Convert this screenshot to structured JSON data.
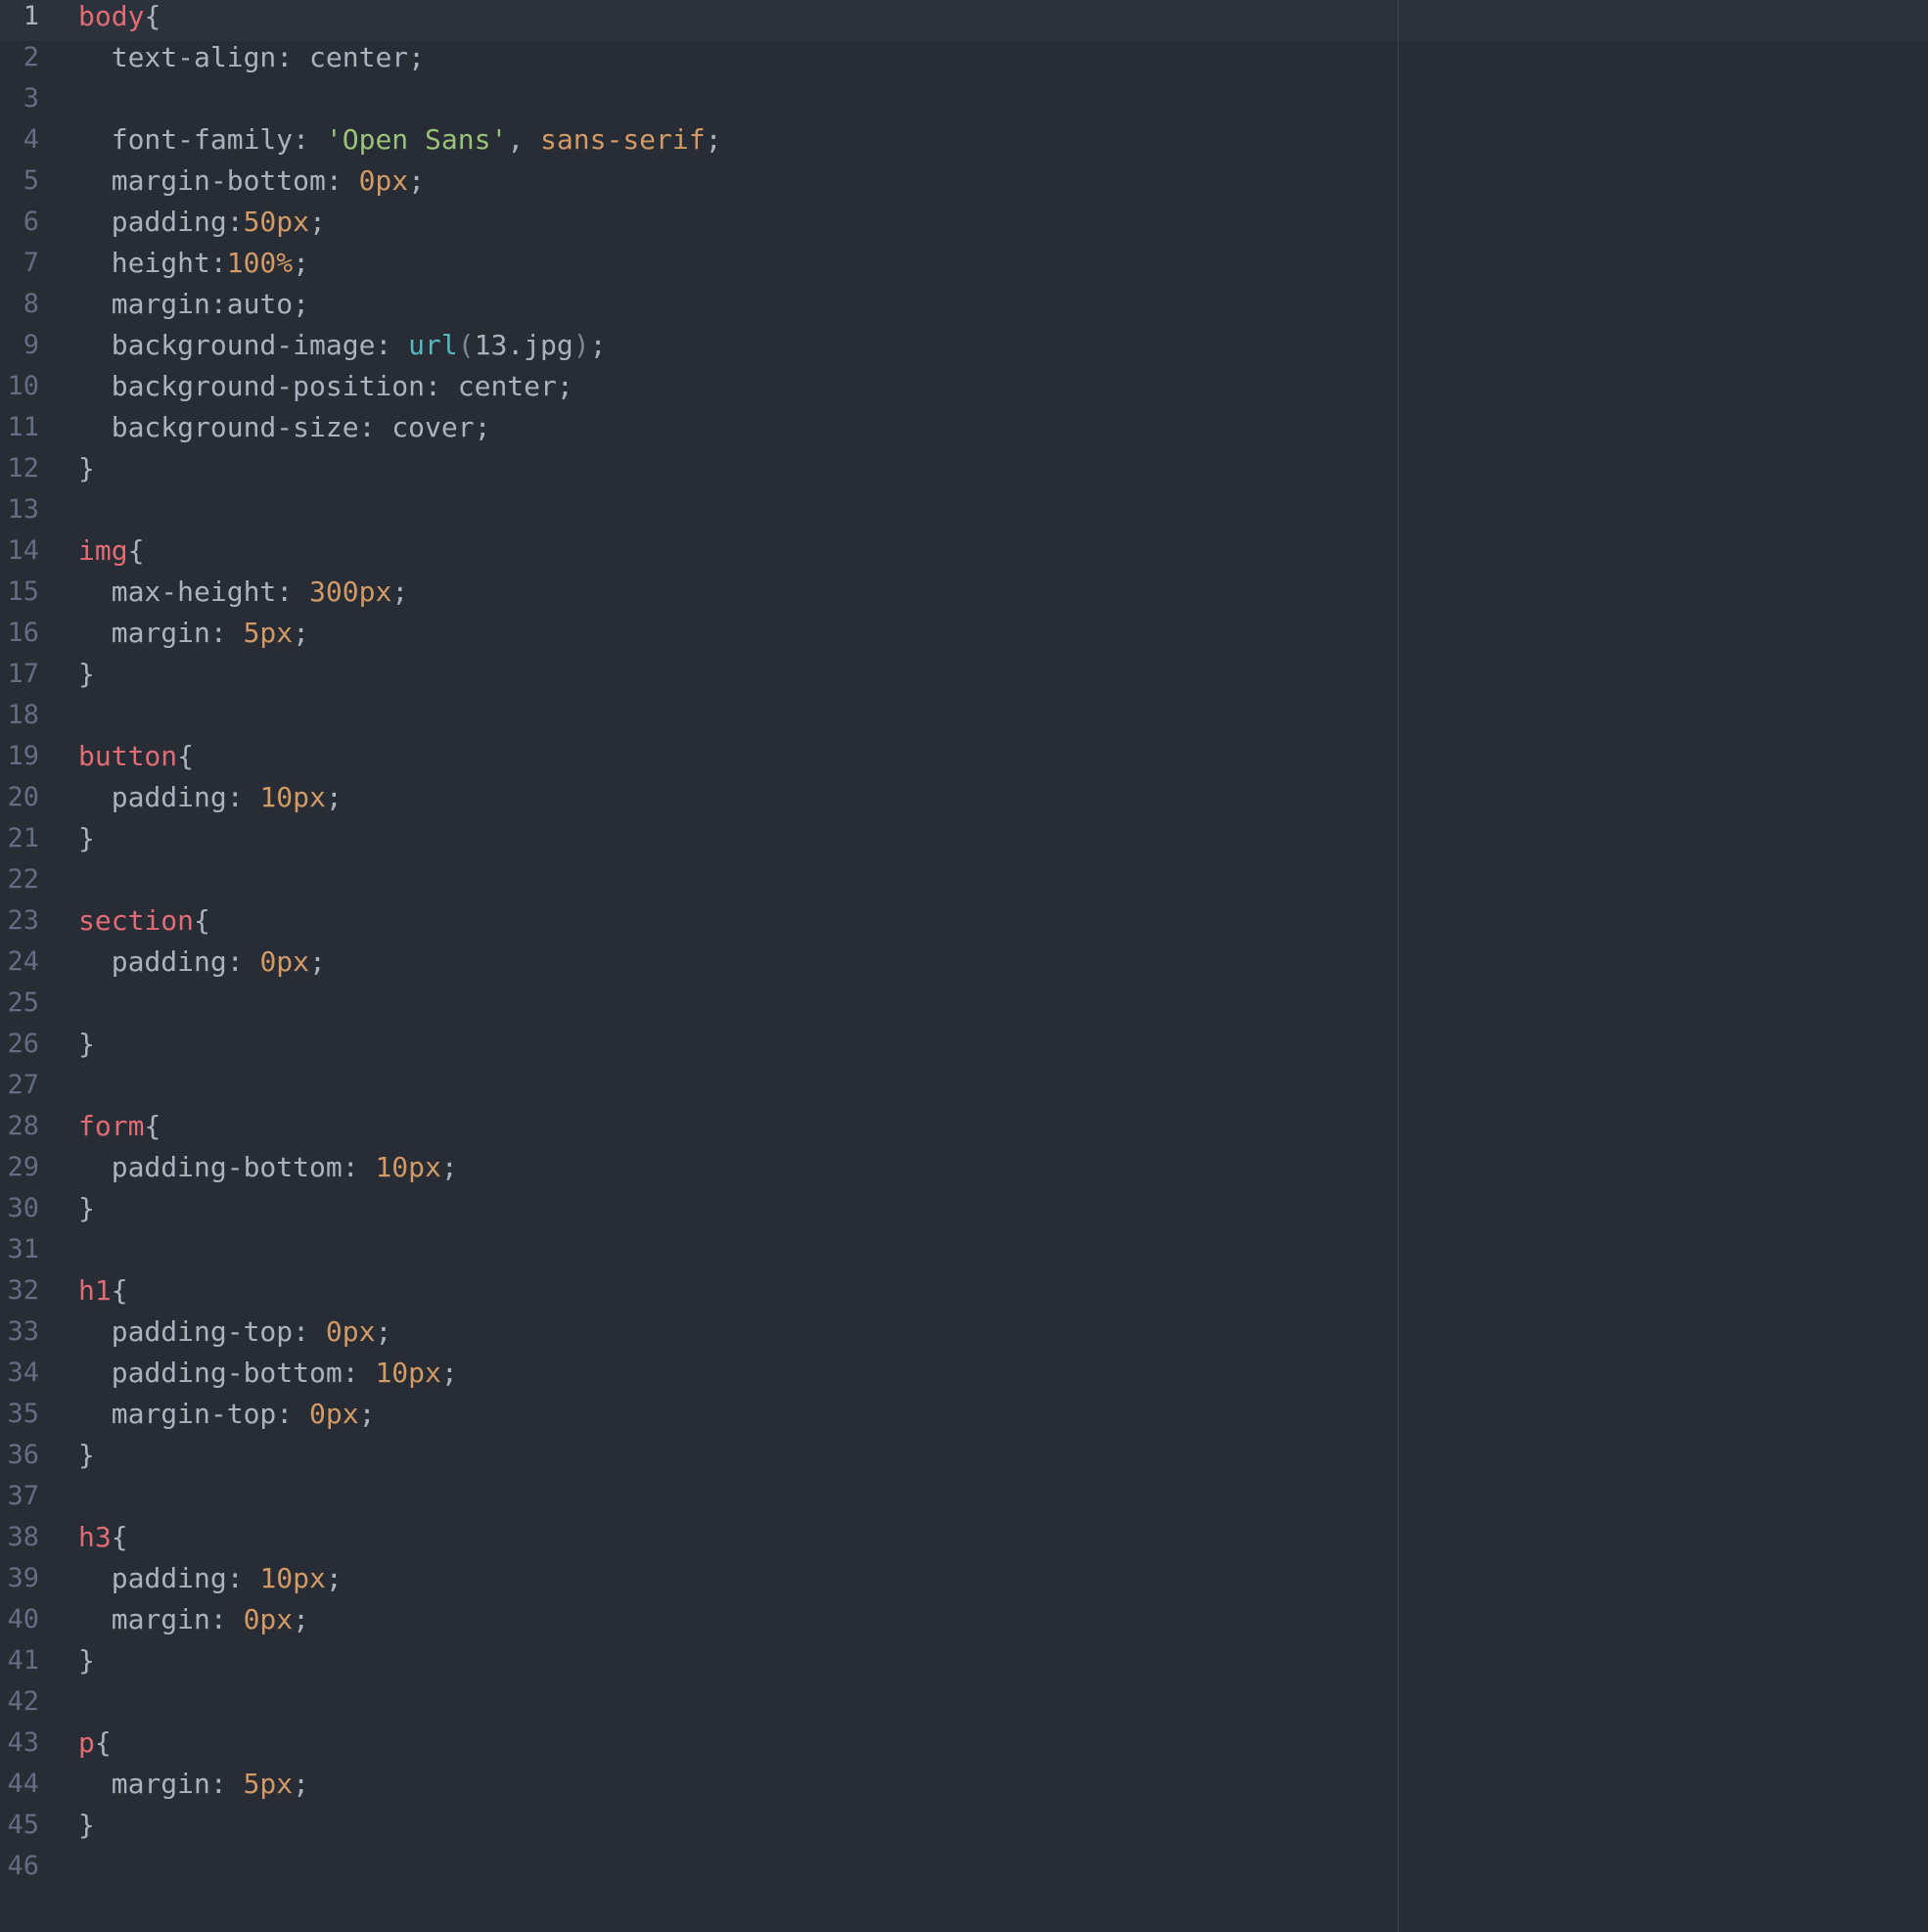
{
  "colors": {
    "background": "#282c34",
    "active_line": "#2d313b",
    "gutter_text": "#636d83",
    "selector": "#e06c75",
    "property": "#abb2bf",
    "number": "#d19a66",
    "string": "#98c379",
    "function": "#56b6c2",
    "wrap_guide": "#3e4451"
  },
  "editor": {
    "active_line": 1,
    "lines": [
      {
        "n": "1",
        "tokens": [
          {
            "t": "sel",
            "v": "body"
          },
          {
            "t": "punc",
            "v": "{"
          }
        ]
      },
      {
        "n": "2",
        "tokens": [
          {
            "t": "prop",
            "v": "  text-align: "
          },
          {
            "t": "plain",
            "v": "center"
          },
          {
            "t": "punc",
            "v": ";"
          }
        ]
      },
      {
        "n": "3",
        "tokens": []
      },
      {
        "n": "4",
        "tokens": [
          {
            "t": "prop",
            "v": "  font-family: "
          },
          {
            "t": "str",
            "v": "'Open Sans'"
          },
          {
            "t": "punc",
            "v": ", "
          },
          {
            "t": "kw",
            "v": "sans-serif"
          },
          {
            "t": "punc",
            "v": ";"
          }
        ]
      },
      {
        "n": "5",
        "tokens": [
          {
            "t": "prop",
            "v": "  margin-bottom: "
          },
          {
            "t": "num",
            "v": "0px"
          },
          {
            "t": "punc",
            "v": ";"
          }
        ]
      },
      {
        "n": "6",
        "tokens": [
          {
            "t": "prop",
            "v": "  padding:"
          },
          {
            "t": "num",
            "v": "50px"
          },
          {
            "t": "punc",
            "v": ";"
          }
        ]
      },
      {
        "n": "7",
        "tokens": [
          {
            "t": "prop",
            "v": "  height:"
          },
          {
            "t": "num",
            "v": "100%"
          },
          {
            "t": "punc",
            "v": ";"
          }
        ]
      },
      {
        "n": "8",
        "tokens": [
          {
            "t": "prop",
            "v": "  margin:"
          },
          {
            "t": "plain",
            "v": "auto"
          },
          {
            "t": "punc",
            "v": ";"
          }
        ]
      },
      {
        "n": "9",
        "tokens": [
          {
            "t": "prop",
            "v": "  background-image: "
          },
          {
            "t": "fn",
            "v": "url"
          },
          {
            "t": "paren",
            "v": "("
          },
          {
            "t": "plain",
            "v": "13.jpg"
          },
          {
            "t": "paren",
            "v": ")"
          },
          {
            "t": "punc",
            "v": ";"
          }
        ]
      },
      {
        "n": "10",
        "tokens": [
          {
            "t": "prop",
            "v": "  background-position: "
          },
          {
            "t": "plain",
            "v": "center"
          },
          {
            "t": "punc",
            "v": ";"
          }
        ]
      },
      {
        "n": "11",
        "tokens": [
          {
            "t": "prop",
            "v": "  background-size: "
          },
          {
            "t": "plain",
            "v": "cover"
          },
          {
            "t": "punc",
            "v": ";"
          }
        ]
      },
      {
        "n": "12",
        "tokens": [
          {
            "t": "punc",
            "v": "}"
          }
        ]
      },
      {
        "n": "13",
        "tokens": []
      },
      {
        "n": "14",
        "tokens": [
          {
            "t": "sel",
            "v": "img"
          },
          {
            "t": "punc",
            "v": "{"
          }
        ]
      },
      {
        "n": "15",
        "tokens": [
          {
            "t": "prop",
            "v": "  max-height: "
          },
          {
            "t": "num",
            "v": "300px"
          },
          {
            "t": "punc",
            "v": ";"
          }
        ]
      },
      {
        "n": "16",
        "tokens": [
          {
            "t": "prop",
            "v": "  margin: "
          },
          {
            "t": "num",
            "v": "5px"
          },
          {
            "t": "punc",
            "v": ";"
          }
        ]
      },
      {
        "n": "17",
        "tokens": [
          {
            "t": "punc",
            "v": "}"
          }
        ]
      },
      {
        "n": "18",
        "tokens": []
      },
      {
        "n": "19",
        "tokens": [
          {
            "t": "sel",
            "v": "button"
          },
          {
            "t": "punc",
            "v": "{"
          }
        ]
      },
      {
        "n": "20",
        "tokens": [
          {
            "t": "prop",
            "v": "  padding: "
          },
          {
            "t": "num",
            "v": "10px"
          },
          {
            "t": "punc",
            "v": ";"
          }
        ]
      },
      {
        "n": "21",
        "tokens": [
          {
            "t": "punc",
            "v": "}"
          }
        ]
      },
      {
        "n": "22",
        "tokens": []
      },
      {
        "n": "23",
        "tokens": [
          {
            "t": "sel",
            "v": "section"
          },
          {
            "t": "punc",
            "v": "{"
          }
        ]
      },
      {
        "n": "24",
        "tokens": [
          {
            "t": "prop",
            "v": "  padding: "
          },
          {
            "t": "num",
            "v": "0px"
          },
          {
            "t": "punc",
            "v": ";"
          }
        ]
      },
      {
        "n": "25",
        "tokens": []
      },
      {
        "n": "26",
        "tokens": [
          {
            "t": "punc",
            "v": "}"
          }
        ]
      },
      {
        "n": "27",
        "tokens": []
      },
      {
        "n": "28",
        "tokens": [
          {
            "t": "sel",
            "v": "form"
          },
          {
            "t": "punc",
            "v": "{"
          }
        ]
      },
      {
        "n": "29",
        "tokens": [
          {
            "t": "prop",
            "v": "  padding-bottom: "
          },
          {
            "t": "num",
            "v": "10px"
          },
          {
            "t": "punc",
            "v": ";"
          }
        ]
      },
      {
        "n": "30",
        "tokens": [
          {
            "t": "punc",
            "v": "}"
          }
        ]
      },
      {
        "n": "31",
        "tokens": []
      },
      {
        "n": "32",
        "tokens": [
          {
            "t": "sel",
            "v": "h1"
          },
          {
            "t": "punc",
            "v": "{"
          }
        ]
      },
      {
        "n": "33",
        "tokens": [
          {
            "t": "prop",
            "v": "  padding-top: "
          },
          {
            "t": "num",
            "v": "0px"
          },
          {
            "t": "punc",
            "v": ";"
          }
        ]
      },
      {
        "n": "34",
        "tokens": [
          {
            "t": "prop",
            "v": "  padding-bottom: "
          },
          {
            "t": "num",
            "v": "10px"
          },
          {
            "t": "punc",
            "v": ";"
          }
        ]
      },
      {
        "n": "35",
        "tokens": [
          {
            "t": "prop",
            "v": "  margin-top: "
          },
          {
            "t": "num",
            "v": "0px"
          },
          {
            "t": "punc",
            "v": ";"
          }
        ]
      },
      {
        "n": "36",
        "tokens": [
          {
            "t": "punc",
            "v": "}"
          }
        ]
      },
      {
        "n": "37",
        "tokens": []
      },
      {
        "n": "38",
        "tokens": [
          {
            "t": "sel",
            "v": "h3"
          },
          {
            "t": "punc",
            "v": "{"
          }
        ]
      },
      {
        "n": "39",
        "tokens": [
          {
            "t": "prop",
            "v": "  padding: "
          },
          {
            "t": "num",
            "v": "10px"
          },
          {
            "t": "punc",
            "v": ";"
          }
        ]
      },
      {
        "n": "40",
        "tokens": [
          {
            "t": "prop",
            "v": "  margin: "
          },
          {
            "t": "num",
            "v": "0px"
          },
          {
            "t": "punc",
            "v": ";"
          }
        ]
      },
      {
        "n": "41",
        "tokens": [
          {
            "t": "punc",
            "v": "}"
          }
        ]
      },
      {
        "n": "42",
        "tokens": []
      },
      {
        "n": "43",
        "tokens": [
          {
            "t": "sel",
            "v": "p"
          },
          {
            "t": "punc",
            "v": "{"
          }
        ]
      },
      {
        "n": "44",
        "tokens": [
          {
            "t": "prop",
            "v": "  margin: "
          },
          {
            "t": "num",
            "v": "5px"
          },
          {
            "t": "punc",
            "v": ";"
          }
        ]
      },
      {
        "n": "45",
        "tokens": [
          {
            "t": "punc",
            "v": "}"
          }
        ]
      },
      {
        "n": "46",
        "tokens": []
      }
    ]
  }
}
